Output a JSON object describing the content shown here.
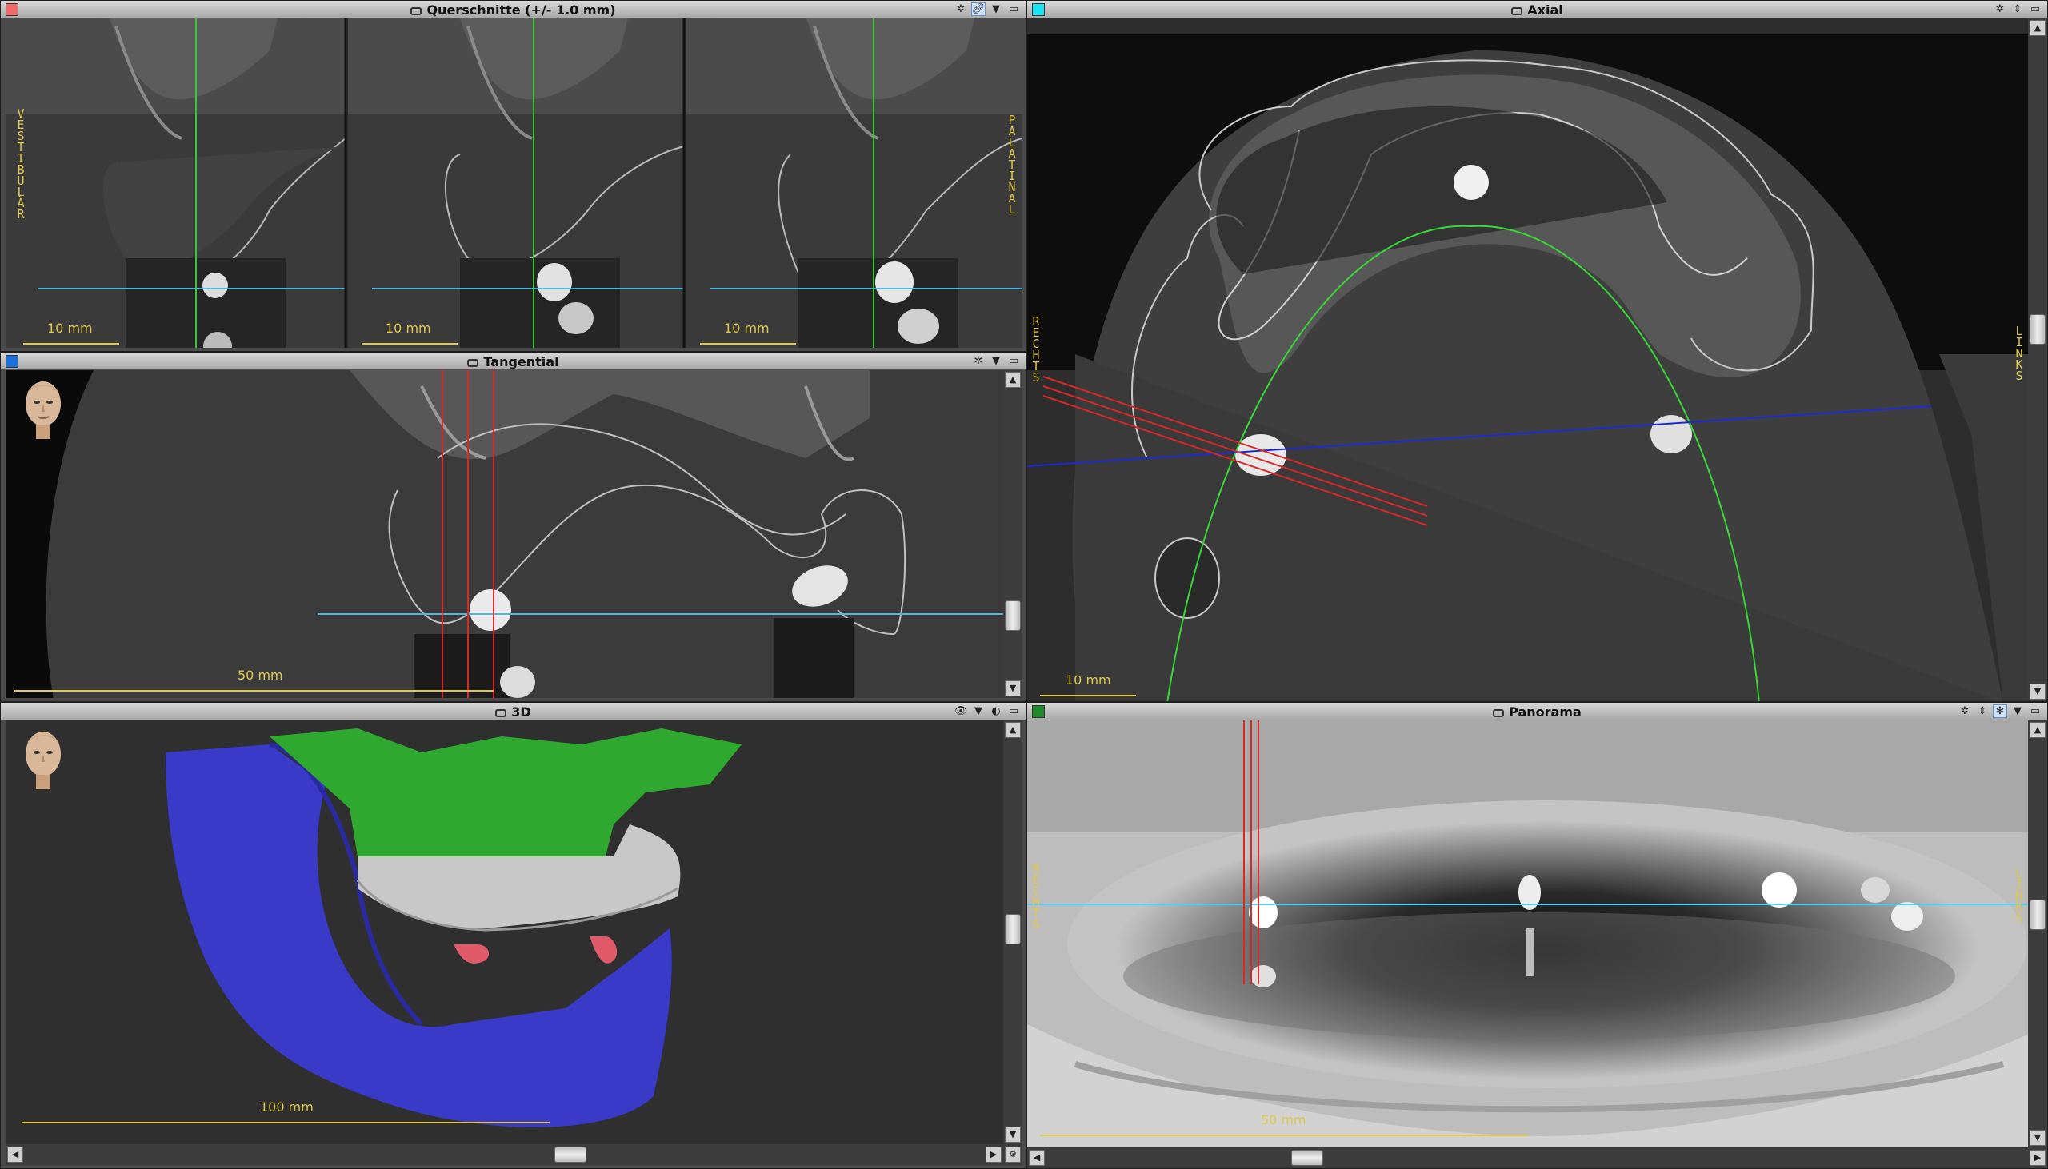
{
  "panes": {
    "querschnitte": {
      "title": "Querschnitte (+/- 1.0 mm)",
      "color": "#f06a6a",
      "left_label": "VESTIBULÄR",
      "right_label": "PALATINAL",
      "scale_labels": [
        "10 mm",
        "10 mm",
        "10 mm"
      ]
    },
    "axial": {
      "title": "Axial",
      "color": "#19e5f0",
      "left_label": "RECHTS",
      "right_label": "LINKS",
      "scale_label": "10 mm"
    },
    "tangential": {
      "title": "Tangential",
      "color": "#1a6fd8",
      "scale_label": "50 mm"
    },
    "three_d": {
      "title": "3D",
      "scale_label": "100 mm"
    },
    "panorama": {
      "title": "Panorama",
      "color": "#1e8a2a",
      "left_label": "RECHTS",
      "right_label": "LINKS",
      "scale_label": "50 mm"
    }
  },
  "icons": [
    "camera-icon",
    "tools-icon",
    "link-icon",
    "dropdown-icon",
    "maximize-icon",
    "eye-icon",
    "settings-gear-icon",
    "head-orientation-icon"
  ]
}
